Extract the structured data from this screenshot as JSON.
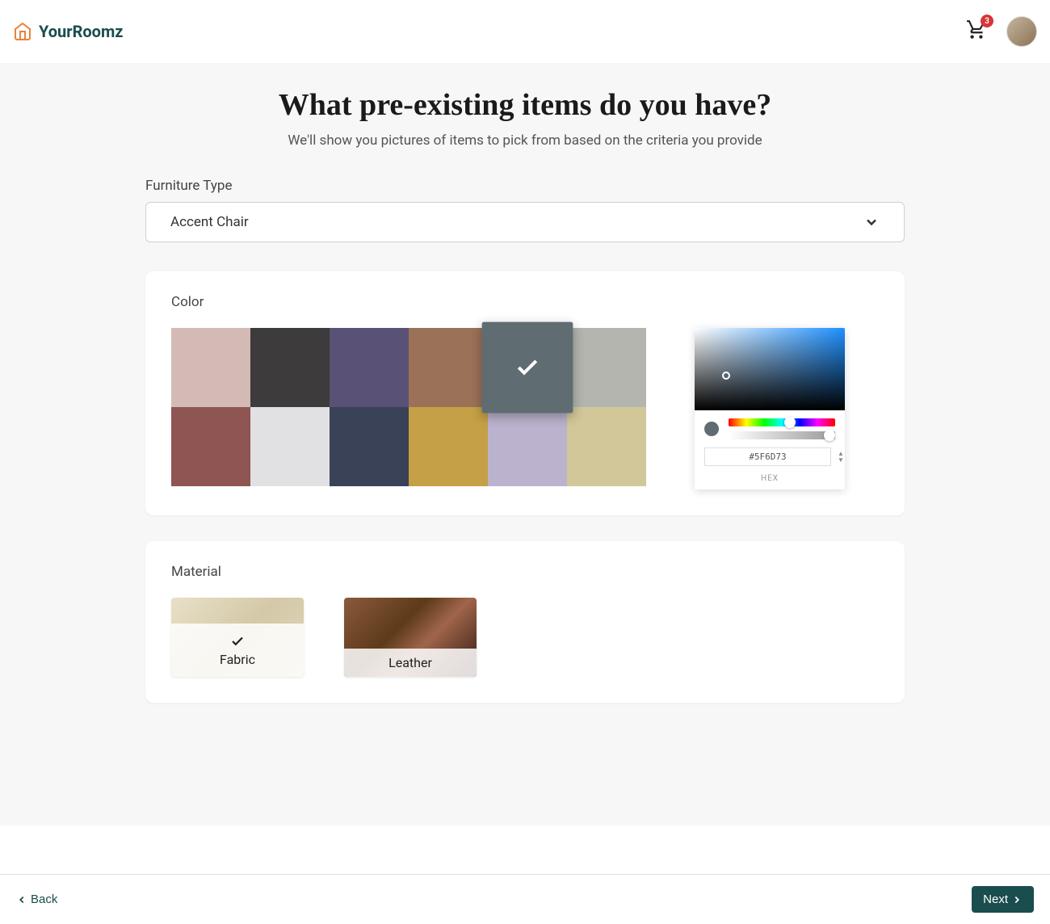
{
  "brand": "YourRoomz",
  "cart_count": "3",
  "page_title": "What pre-existing items do you have?",
  "page_subtitle": "We'll show you pictures of items to pick from based on the criteria you provide",
  "furniture_type": {
    "label": "Furniture Type",
    "value": "Accent Chair"
  },
  "color": {
    "label": "Color",
    "swatches": [
      "#d4bab5",
      "#3d3b3b",
      "#5a5276",
      "#9b7158",
      "#5f6d73",
      "#b3b5ae",
      "#8e5553",
      "#e1e1e3",
      "#3a4258",
      "#c5a046",
      "#bbb3ce",
      "#d1c799"
    ],
    "selected_index": 4,
    "hex_value": "#5F6D73",
    "hex_label": "HEX"
  },
  "material": {
    "label": "Material",
    "options": [
      {
        "name": "Fabric",
        "selected": true
      },
      {
        "name": "Leather",
        "selected": false
      }
    ]
  },
  "nav": {
    "back": "Back",
    "next": "Next"
  }
}
